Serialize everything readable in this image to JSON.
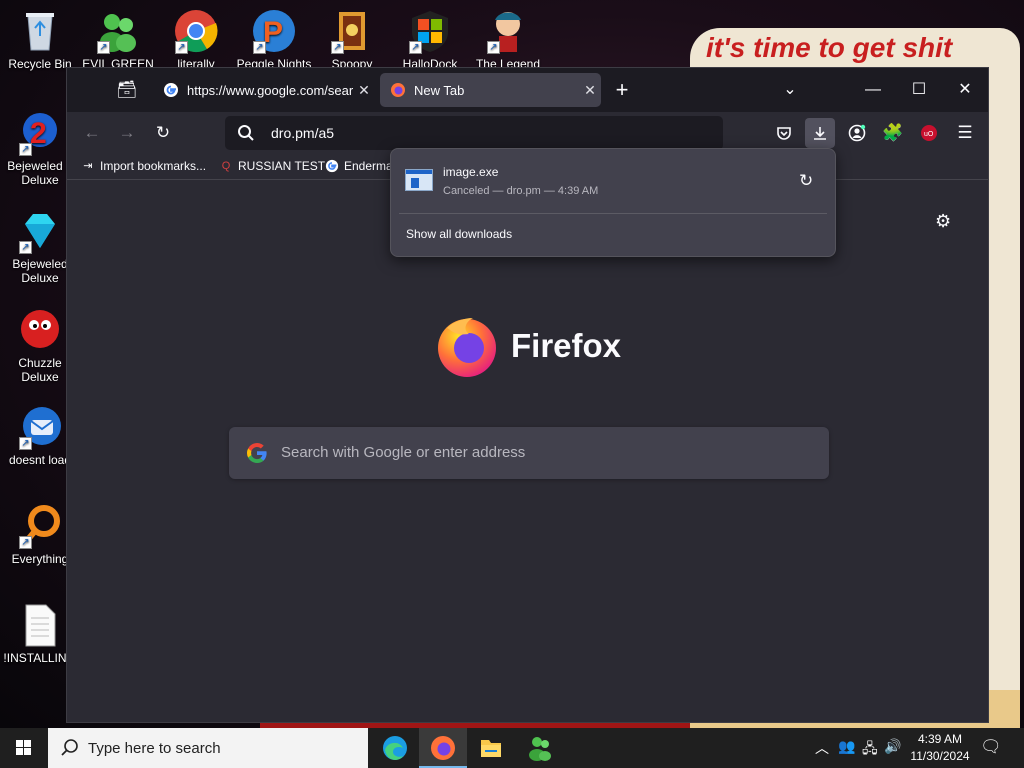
{
  "desktop": {
    "banner_text": "it's time to get shit",
    "icons": [
      {
        "label": "Recycle Bin",
        "icon": "recycle-bin-icon"
      },
      {
        "label": "EVIL GREEN",
        "icon": "green-people-icon"
      },
      {
        "label": "literally",
        "icon": "chrome-icon"
      },
      {
        "label": "Peggle Nights",
        "icon": "peggle-icon"
      },
      {
        "label": "Spoopy",
        "icon": "spooky-icon"
      },
      {
        "label": "HalloDock",
        "icon": "windows-logo-icon"
      },
      {
        "label": "The Legend",
        "icon": "character-icon"
      },
      {
        "label": "Bejeweled 2 Deluxe",
        "icon": "bejeweled-2-icon"
      },
      {
        "label": "Bejeweled Deluxe",
        "icon": "gem-icon"
      },
      {
        "label": "Chuzzle Deluxe",
        "icon": "chuzzle-icon"
      },
      {
        "label": "doesnt load",
        "icon": "thunderbird-icon"
      },
      {
        "label": "Everything",
        "icon": "everything-search-icon"
      },
      {
        "label": "!INSTALLIN...",
        "icon": "document-icon"
      }
    ]
  },
  "browser": {
    "tabs": [
      {
        "title": "https://www.google.com/searc",
        "favicon": "google-icon",
        "active": false
      },
      {
        "title": "New Tab",
        "favicon": "firefox-icon",
        "active": true
      }
    ],
    "new_tab_label": "+",
    "url": "dro.pm/a5",
    "bookmarks": [
      {
        "label": "Import bookmarks...",
        "icon": "import-icon"
      },
      {
        "label": "RUSSIAN TEST",
        "icon": "magnifier-icon"
      },
      {
        "label": "Enderma",
        "icon": "google-icon"
      }
    ],
    "logo_text": "Firefox",
    "search_placeholder": "Search with Google or enter address"
  },
  "downloads_panel": {
    "file_name": "image.exe",
    "status": "Canceled — dro.pm — 4:39 AM",
    "show_all_label": "Show all downloads"
  },
  "taskbar": {
    "search_placeholder": "Type here to search",
    "apps": [
      "edge-icon",
      "firefox-icon",
      "file-explorer-icon",
      "green-people-icon"
    ],
    "time": "4:39 AM",
    "date": "11/30/2024"
  },
  "colors": {
    "browser_toolbar": "#2b2a33",
    "browser_tabbar": "#1c1b22",
    "panel_bg": "#42414d",
    "text": "#fbfbfe",
    "taskbar": "#1f1f1f"
  }
}
